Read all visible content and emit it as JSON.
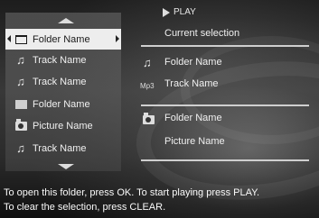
{
  "list": {
    "items": [
      {
        "icon": "folder-icon",
        "label": "Folder Name",
        "selected": true
      },
      {
        "icon": "music-note-icon",
        "label": "Track Name"
      },
      {
        "icon": "music-note-icon",
        "label": "Track Name"
      },
      {
        "icon": "folder-icon",
        "label": "Folder Name"
      },
      {
        "icon": "camera-icon",
        "label": "Picture Name"
      },
      {
        "icon": "music-note-icon",
        "label": "Track Name"
      }
    ]
  },
  "info": {
    "play_label": "PLAY",
    "current_selection": "Current selection",
    "folder_name": "Folder Name",
    "mp3_badge": "Mp3",
    "track_name": "Track Name",
    "picture_folder_name": "Folder Name",
    "picture_name": "Picture Name"
  },
  "footer": {
    "line1": "To open this folder, press OK. To start playing press PLAY.",
    "line2": "To clear the selection, press CLEAR."
  }
}
